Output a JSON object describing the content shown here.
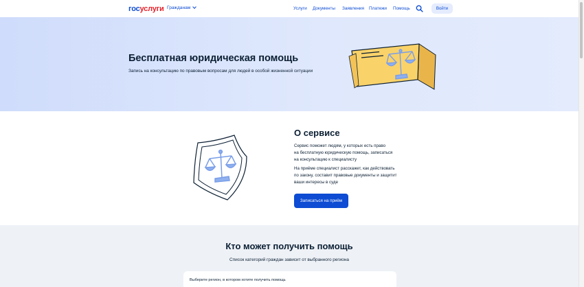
{
  "header": {
    "logo": {
      "part1": "гос",
      "part2": "услуги"
    },
    "citizens_menu": "Гражданам",
    "nav": [
      "Услуги",
      "Документы",
      "Заявления",
      "Платежи",
      "Помощь"
    ],
    "login": "Войти"
  },
  "hero": {
    "title": "Бесплатная юридическая помощь",
    "subtitle": "Запись на консультацию по правовым вопросам для людей в особой жизненной ситуации"
  },
  "about": {
    "title": "О сервисе",
    "paragraph1": [
      "Сервис поможет людям, у которых есть право",
      "на бесплатную юридическую помощь, записаться",
      "на консультацию к специалисту"
    ],
    "paragraph2": [
      "На приёме специалист расскажет, как действовать",
      "по закону, составит правовые документы и защитит",
      "ваши интересы в суде"
    ],
    "button": "Записаться на приём"
  },
  "who": {
    "title": "Кто может получить помощь",
    "subtitle": "Список категорий граждан зависит от выбранного региона",
    "region_label": "Выберите регион, в котором хотите получить помощь"
  },
  "colors": {
    "brand_blue": "#0d4cd3",
    "brand_red": "#e4232c",
    "hero_bg": "#d8e3fc",
    "page_bg": "#eef1f6",
    "card_yellow": "#f9d26a"
  },
  "icons": [
    "search-icon",
    "chevron-down-icon",
    "legal-scales-sign-illustration",
    "shield-scales-illustration"
  ]
}
